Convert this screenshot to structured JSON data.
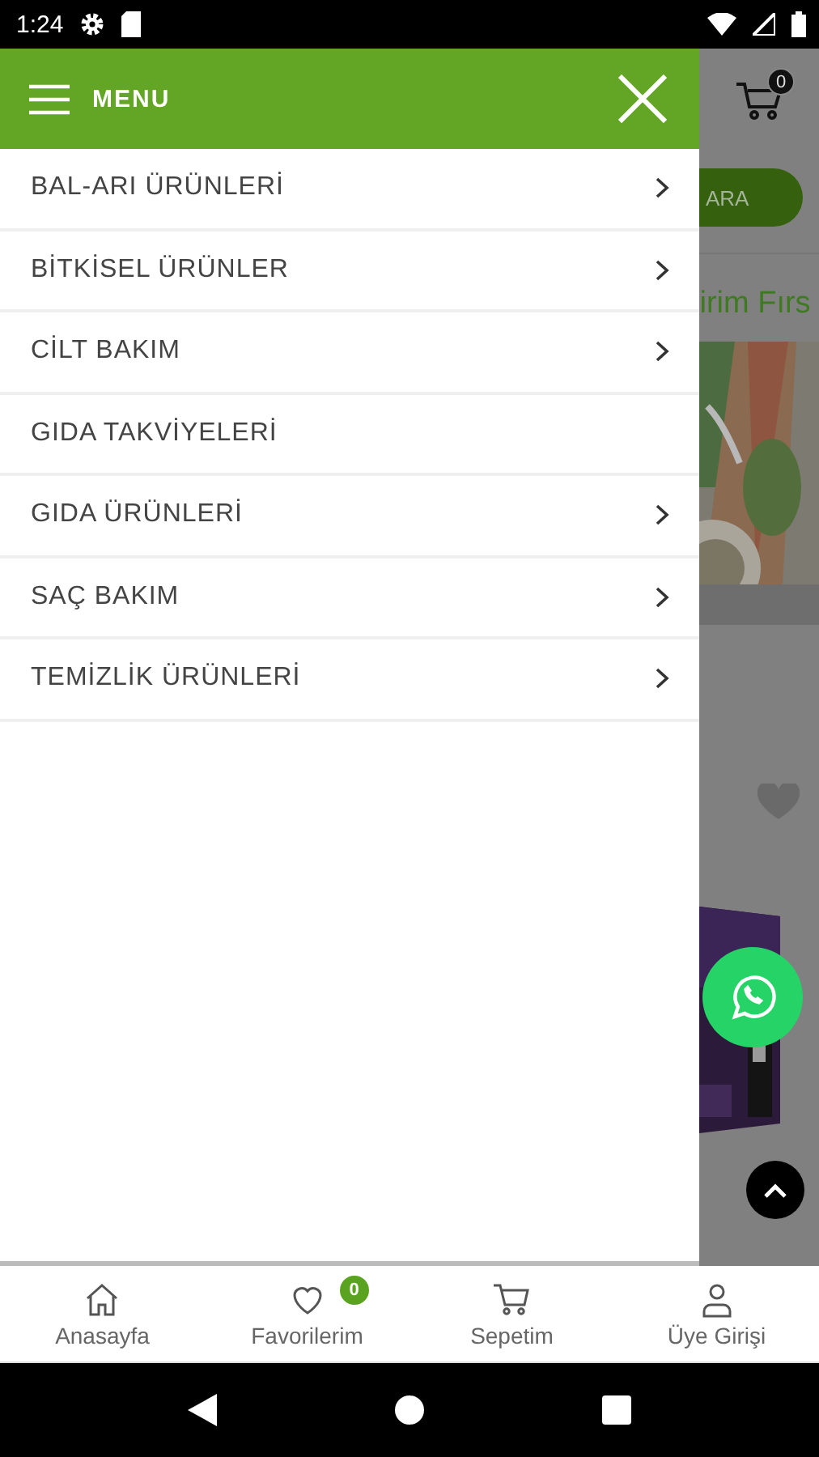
{
  "status_bar": {
    "time": "1:24"
  },
  "drawer": {
    "title": "MENU",
    "items": [
      {
        "label": "BAL-ARI ÜRÜNLERİ",
        "has_children": true
      },
      {
        "label": "BİTKİSEL ÜRÜNLER",
        "has_children": true
      },
      {
        "label": "CİLT BAKIM",
        "has_children": true
      },
      {
        "label": "GIDA TAKVİYELERİ",
        "has_children": false
      },
      {
        "label": "GIDA ÜRÜNLERİ",
        "has_children": true
      },
      {
        "label": "SAÇ BAKIM",
        "has_children": true
      },
      {
        "label": "TEMİZLİK ÜRÜNLERİ",
        "has_children": true
      }
    ]
  },
  "background": {
    "cart_badge": "0",
    "search_button": "ARA",
    "heading": "lirim Fırs"
  },
  "bottom_nav": [
    {
      "kind": "home",
      "label": "Anasayfa"
    },
    {
      "kind": "favorites",
      "label": "Favorilerim",
      "badge": "0"
    },
    {
      "kind": "cart",
      "label": "Sepetim"
    },
    {
      "kind": "account",
      "label": "Üye Girişi"
    }
  ]
}
